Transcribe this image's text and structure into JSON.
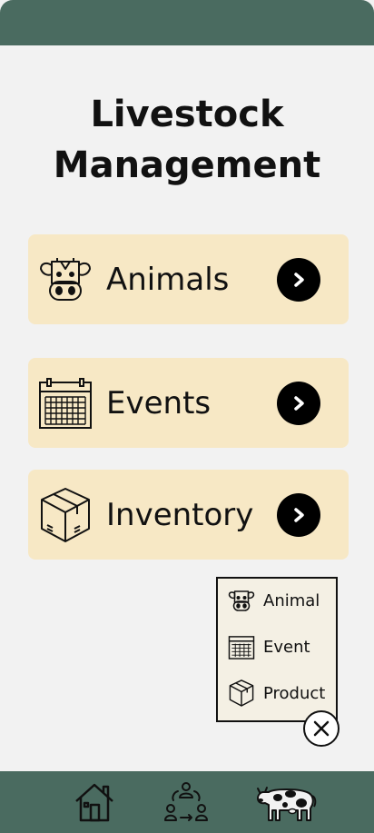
{
  "header": {
    "title_line1": "Livestock",
    "title_line2": "Management"
  },
  "cards": [
    {
      "label": "Animals",
      "icon": "cow-face-icon"
    },
    {
      "label": "Events",
      "icon": "calendar-icon"
    },
    {
      "label": "Inventory",
      "icon": "box-icon"
    }
  ],
  "popup": {
    "items": [
      {
        "label": "Animal",
        "icon": "cow-face-icon"
      },
      {
        "label": "Event",
        "icon": "calendar-icon"
      },
      {
        "label": "Product",
        "icon": "box-icon"
      }
    ]
  },
  "bottom_nav": {
    "items": [
      {
        "icon": "home-icon"
      },
      {
        "icon": "people-exchange-icon"
      },
      {
        "icon": "cow-icon"
      }
    ]
  },
  "colors": {
    "bar": "#4a6b60",
    "card": "#f7e8c5",
    "popup": "#f4f0e4",
    "background": "#f2f2f2"
  }
}
